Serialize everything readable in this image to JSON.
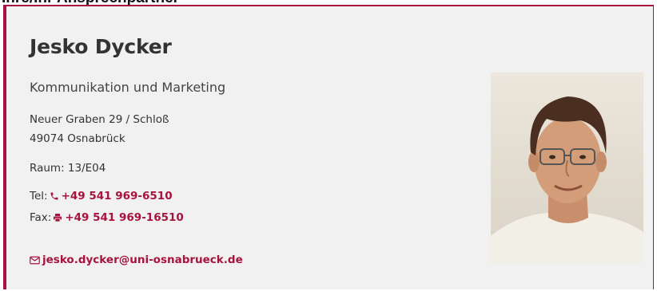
{
  "header": {
    "cut_off_text": "Ihre/Ihr Ansprechpartner"
  },
  "contact": {
    "name": "Jesko Dycker",
    "department": "Kommunikation und Marketing",
    "address_line1": "Neuer Graben 29 / Schloß",
    "address_line2": "49074 Osnabrück",
    "room": "Raum: 13/E04",
    "tel_label": "Tel:",
    "tel_number": "+49 541 969-6510",
    "fax_label": "Fax:",
    "fax_number": "+49 541 969-16510",
    "email": "jesko.dycker@uni-osnabrueck.de"
  },
  "icons": {
    "tel": "phone-icon",
    "fax": "printer-icon",
    "email": "envelope-icon"
  },
  "colors": {
    "accent": "#a8123e",
    "card_bg": "#f1f1f1",
    "text": "#333333"
  }
}
